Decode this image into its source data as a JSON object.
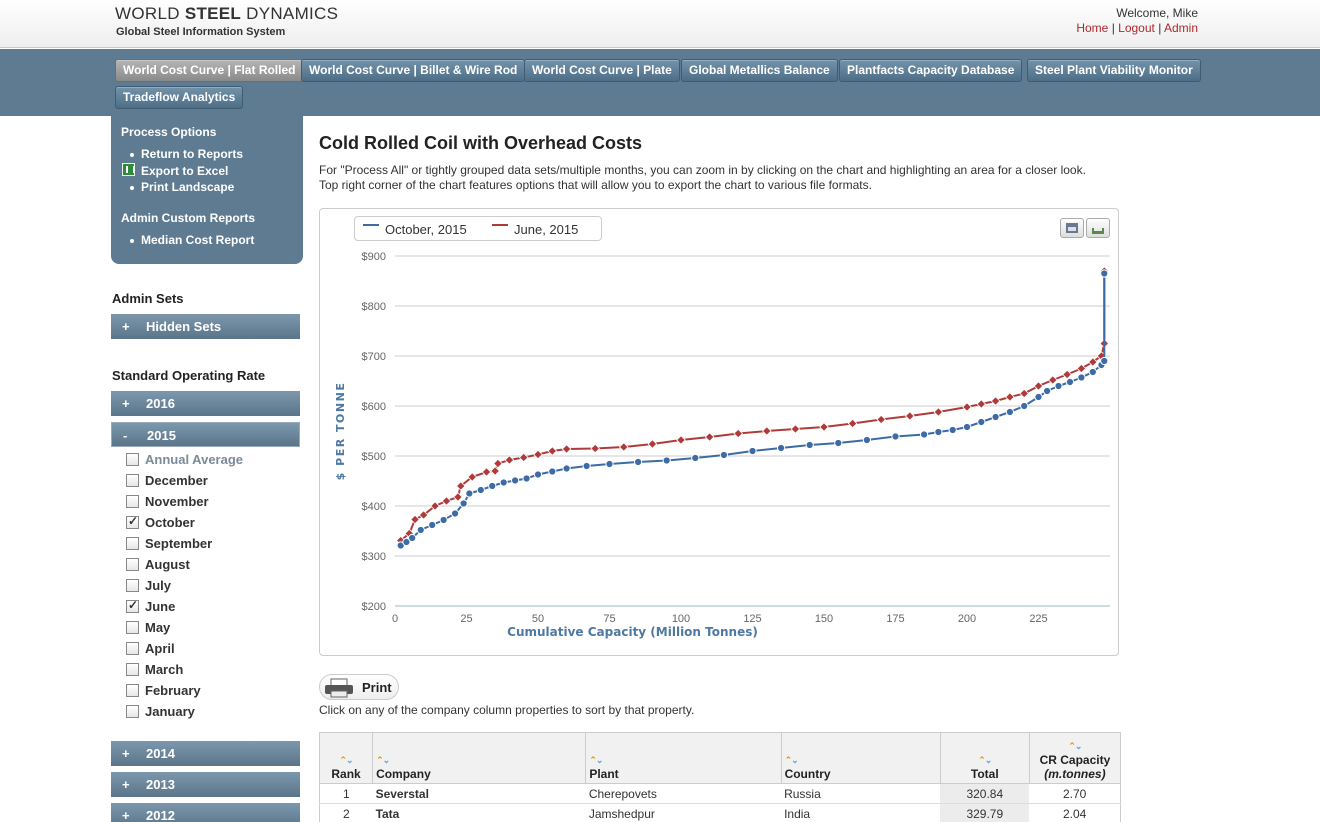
{
  "header": {
    "logo_part1": "WORLD ",
    "logo_bold": "STEEL",
    "logo_part2": " DYNAMICS",
    "subtitle": "Global Steel Information System",
    "welcome": "Welcome, Mike",
    "links": [
      "Home",
      "Logout",
      "Admin"
    ]
  },
  "nav": {
    "tabs": [
      "World Cost Curve | Flat Rolled",
      "World Cost Curve | Billet & Wire Rod",
      "World Cost Curve | Plate",
      "Global Metallics Balance",
      "Plantfacts Capacity Database",
      "Steel Plant Viability Monitor",
      "Tradeflow Analytics"
    ],
    "active_index": 0
  },
  "sidebar": {
    "process_title": "Process Options",
    "process_links": [
      "Return to Reports",
      "Export to Excel",
      "Print Landscape"
    ],
    "admin_custom_title": "Admin Custom Reports",
    "admin_custom_links": [
      "Median Cost Report"
    ],
    "admin_sets_title": "Admin Sets",
    "hidden_sets": {
      "sign": "+",
      "label": "Hidden Sets"
    },
    "sor_title": "Standard Operating Rate",
    "years": [
      {
        "sign": "+",
        "label": "2016"
      },
      {
        "sign": "-",
        "label": "2015"
      },
      {
        "sign": "+",
        "label": "2014"
      },
      {
        "sign": "+",
        "label": "2013"
      },
      {
        "sign": "+",
        "label": "2012"
      }
    ],
    "months": [
      {
        "label": "Annual Average",
        "checked": false
      },
      {
        "label": "December",
        "checked": false
      },
      {
        "label": "November",
        "checked": false
      },
      {
        "label": "October",
        "checked": true
      },
      {
        "label": "September",
        "checked": false
      },
      {
        "label": "August",
        "checked": false
      },
      {
        "label": "July",
        "checked": false
      },
      {
        "label": "June",
        "checked": true
      },
      {
        "label": "May",
        "checked": false
      },
      {
        "label": "April",
        "checked": false
      },
      {
        "label": "March",
        "checked": false
      },
      {
        "label": "February",
        "checked": false
      },
      {
        "label": "January",
        "checked": false
      }
    ]
  },
  "main": {
    "title": "Cold Rolled Coil with Overhead Costs",
    "desc1": "For \"Process All\" or tightly grouped data sets/multiple months, you can zoom in by clicking on the chart and highlighting an area for a closer look.",
    "desc2": "Top right corner of the chart features options that will allow you to export the chart to various file formats.",
    "print_label": "Print",
    "sort_hint": "Click on any of the company column properties to sort by that property."
  },
  "chart_data": {
    "type": "line",
    "title": "",
    "xlabel": "Cumulative Capacity (Million Tonnes)",
    "ylabel": "$ PER TONNE",
    "xlim": [
      0,
      250
    ],
    "ylim": [
      200,
      900
    ],
    "xticks": [
      "0",
      "25",
      "50",
      "75",
      "100",
      "125",
      "150",
      "175",
      "200",
      "225"
    ],
    "yticks": [
      "$200",
      "$300",
      "$400",
      "$500",
      "$600",
      "$700",
      "$800",
      "$900"
    ],
    "legend": "top-left",
    "grid": true,
    "series": [
      {
        "name": "October, 2015",
        "color": "#3d6ba5",
        "points": [
          [
            2,
            321
          ],
          [
            4,
            328
          ],
          [
            6,
            336
          ],
          [
            9,
            352
          ],
          [
            13,
            362
          ],
          [
            17,
            372
          ],
          [
            21,
            385
          ],
          [
            24,
            405
          ],
          [
            26,
            425
          ],
          [
            30,
            432
          ],
          [
            34,
            440
          ],
          [
            38,
            447
          ],
          [
            42,
            451
          ],
          [
            46,
            455
          ],
          [
            50,
            463
          ],
          [
            55,
            469
          ],
          [
            60,
            475
          ],
          [
            67,
            480
          ],
          [
            75,
            484
          ],
          [
            85,
            488
          ],
          [
            95,
            491
          ],
          [
            105,
            496
          ],
          [
            115,
            502
          ],
          [
            125,
            510
          ],
          [
            135,
            516
          ],
          [
            145,
            522
          ],
          [
            155,
            526
          ],
          [
            165,
            532
          ],
          [
            175,
            539
          ],
          [
            185,
            543
          ],
          [
            190,
            548
          ],
          [
            195,
            552
          ],
          [
            200,
            558
          ],
          [
            205,
            568
          ],
          [
            210,
            578
          ],
          [
            215,
            588
          ],
          [
            220,
            600
          ],
          [
            225,
            618
          ],
          [
            228,
            630
          ],
          [
            232,
            640
          ],
          [
            236,
            648
          ],
          [
            240,
            657
          ],
          [
            244,
            668
          ],
          [
            247,
            682
          ],
          [
            248,
            690
          ],
          [
            248,
            865
          ]
        ]
      },
      {
        "name": "June, 2015",
        "color": "#b03a3a",
        "points": [
          [
            2,
            331
          ],
          [
            5,
            345
          ],
          [
            7,
            373
          ],
          [
            10,
            382
          ],
          [
            14,
            400
          ],
          [
            18,
            410
          ],
          [
            22,
            418
          ],
          [
            23,
            440
          ],
          [
            27,
            458
          ],
          [
            32,
            468
          ],
          [
            35,
            470
          ],
          [
            36,
            485
          ],
          [
            40,
            492
          ],
          [
            45,
            497
          ],
          [
            50,
            503
          ],
          [
            55,
            510
          ],
          [
            60,
            514
          ],
          [
            70,
            515
          ],
          [
            80,
            518
          ],
          [
            90,
            524
          ],
          [
            100,
            532
          ],
          [
            110,
            538
          ],
          [
            120,
            545
          ],
          [
            130,
            550
          ],
          [
            140,
            554
          ],
          [
            150,
            558
          ],
          [
            160,
            565
          ],
          [
            170,
            573
          ],
          [
            180,
            580
          ],
          [
            190,
            588
          ],
          [
            200,
            598
          ],
          [
            205,
            604
          ],
          [
            210,
            610
          ],
          [
            215,
            618
          ],
          [
            220,
            625
          ],
          [
            225,
            640
          ],
          [
            230,
            652
          ],
          [
            235,
            663
          ],
          [
            240,
            675
          ],
          [
            244,
            688
          ],
          [
            247,
            700
          ],
          [
            248,
            725
          ],
          [
            248,
            870
          ]
        ]
      }
    ]
  },
  "table": {
    "columns": [
      "Rank",
      "Company",
      "Plant",
      "Country",
      "Total",
      "CR Capacity"
    ],
    "capacity_unit": "(m.tonnes)",
    "rows": [
      {
        "rank": "1",
        "company": "Severstal",
        "plant": "Cherepovets",
        "country": "Russia",
        "total": "320.84",
        "capacity": "2.70"
      },
      {
        "rank": "2",
        "company": "Tata",
        "plant": "Jamshedpur",
        "country": "India",
        "total": "329.79",
        "capacity": "2.04"
      }
    ]
  }
}
